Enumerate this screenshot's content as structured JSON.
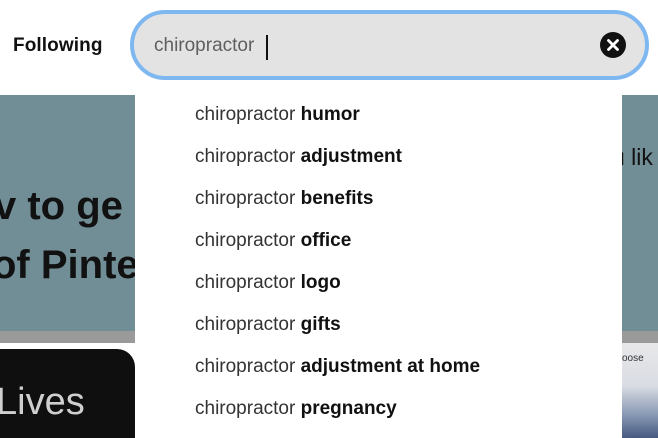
{
  "header": {
    "following_label": "Following",
    "search": {
      "value": "chiropractor",
      "clear_icon": "close-icon"
    }
  },
  "background": {
    "hero_line_1": "v to ge",
    "hero_line_2": "of Pinte",
    "hero_right_text": "u lik",
    "dark_card_text": "Lives",
    "right_card_text": "oose"
  },
  "suggestions": [
    {
      "query": "chiropractor",
      "completion": "humor"
    },
    {
      "query": "chiropractor",
      "completion": "adjustment"
    },
    {
      "query": "chiropractor",
      "completion": "benefits"
    },
    {
      "query": "chiropractor",
      "completion": "office"
    },
    {
      "query": "chiropractor",
      "completion": "logo"
    },
    {
      "query": "chiropractor",
      "completion": "gifts"
    },
    {
      "query": "chiropractor",
      "completion": "adjustment at home"
    },
    {
      "query": "chiropractor",
      "completion": "pregnancy"
    }
  ],
  "colors": {
    "search_focus_ring": "#7fb8f0",
    "search_bg": "#e3e3e3",
    "hero_bg": "#718d95"
  }
}
